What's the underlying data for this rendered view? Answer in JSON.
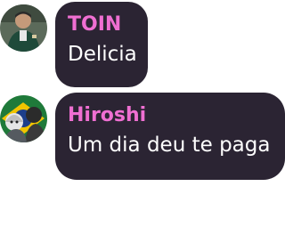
{
  "messages": [
    {
      "author": "TOIN",
      "text": "Delicia",
      "avatar_icon": "user-avatar-icon"
    },
    {
      "author": "Hiroshi",
      "text": "Um dia deu te paga",
      "avatar_icon": "user-avatar-icon"
    }
  ],
  "colors": {
    "bubble_background": "#2b2433",
    "author_name": "#ef6fd2",
    "message_text": "#ffffff"
  }
}
